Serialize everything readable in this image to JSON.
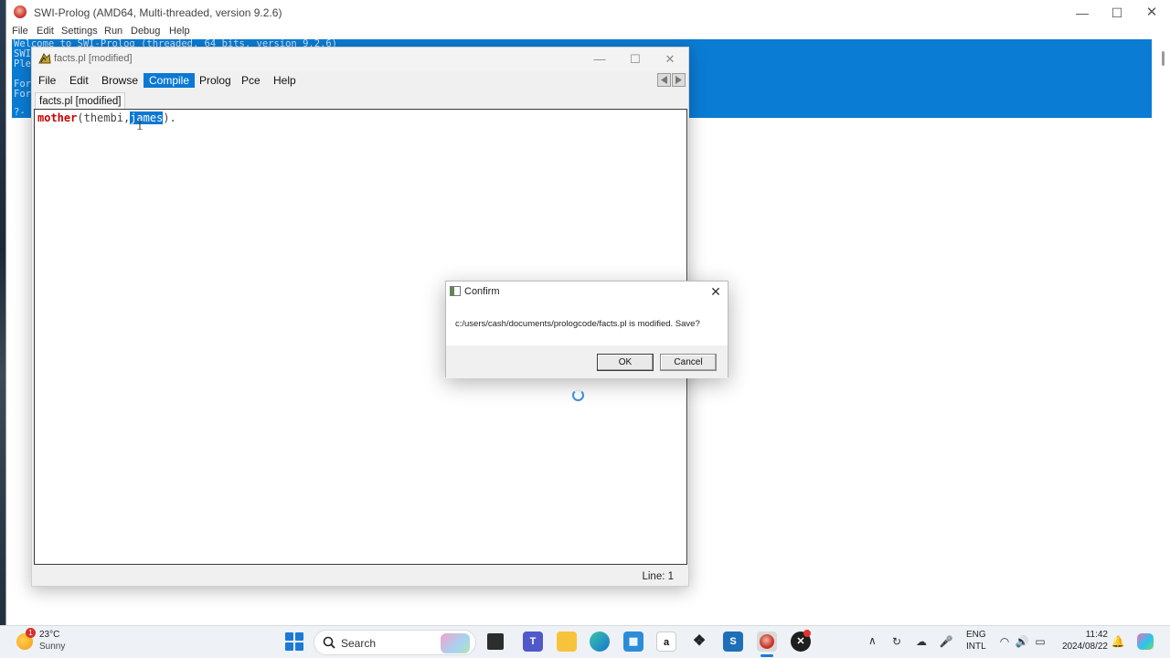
{
  "main_window": {
    "title": "SWI-Prolog (AMD64, Multi-threaded, version 9.2.6)",
    "menu": [
      "File",
      "Edit",
      "Settings",
      "Run",
      "Debug",
      "Help"
    ],
    "console_lines": [
      "Welcome to SWI-Prolog (threaded, 64 bits, version 9.2.6)",
      "SWI",
      "Ple",
      "For",
      "For"
    ],
    "console_prompt": "?-",
    "console_bg": "#0a7cd4"
  },
  "editor": {
    "title": "facts.pl [modified]",
    "menu": {
      "file": "File",
      "edit": "Edit",
      "browse": "Browse",
      "compile": "Compile",
      "prolog": "Prolog",
      "pce": "Pce",
      "help": "Help"
    },
    "active_menu": "Compile",
    "tab_label": "facts.pl [modified]",
    "code": {
      "predicate": "mother",
      "open": "(",
      "arg1": "thembi",
      "comma": ",",
      "arg2": "james",
      "close": ")",
      "dot": "."
    },
    "status_line": "Line: 1",
    "accent": "#0a78d4",
    "predicate_color": "#cc0000"
  },
  "dialog": {
    "title": "Confirm",
    "message": "c:/users/cash/documents/prologcode/facts.pl is modified.  Save?",
    "ok_label": "OK",
    "cancel_label": "Cancel"
  },
  "taskbar": {
    "weather_badge": "1",
    "weather_temp": "23°C",
    "weather_desc": "Sunny",
    "search_label": "Search",
    "amazon_label": "a",
    "s_app_label": "S",
    "lang_top": "ENG",
    "lang_bottom": "INTL",
    "time": "11:42",
    "date": "2024/08/22",
    "icons": [
      "start-icon",
      "search-icon",
      "task-view-icon",
      "teams-icon",
      "file-explorer-icon",
      "edge-icon",
      "store-icon",
      "amazon-icon",
      "dropbox-icon",
      "s-app-icon",
      "swi-prolog-icon",
      "xming-icon",
      "chevron-up-icon",
      "sync-icon",
      "network-off-icon",
      "mic-icon",
      "wifi-icon",
      "volume-icon",
      "battery-icon",
      "bell-icon",
      "copilot-icon"
    ]
  }
}
